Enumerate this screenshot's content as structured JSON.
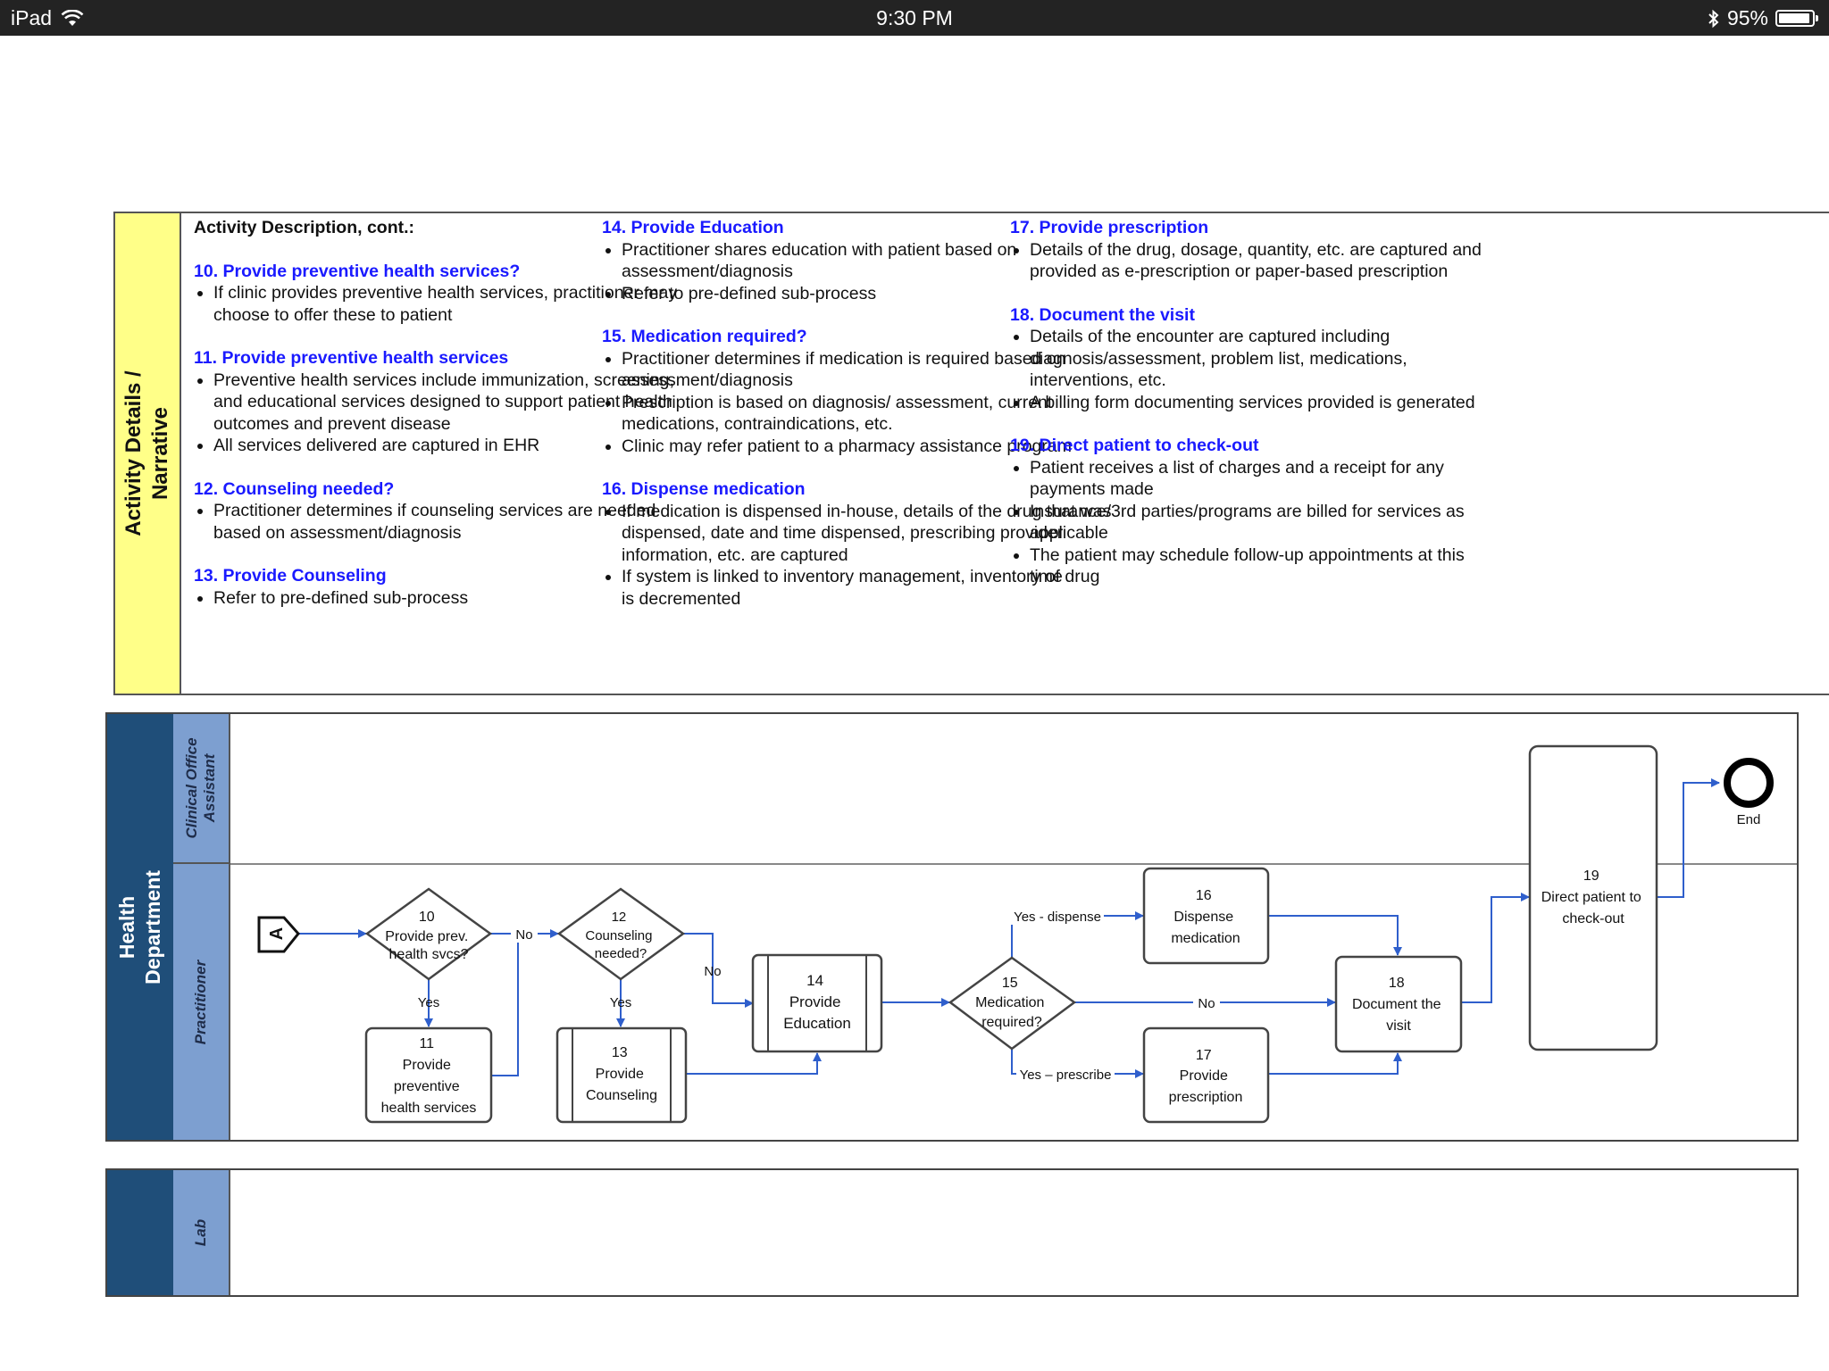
{
  "status_bar": {
    "device": "iPad",
    "time": "9:30 PM",
    "battery": "95%",
    "battery_level": 0.95
  },
  "narrative": {
    "label_line1": "Activity Details /",
    "label_line2": "Narrative",
    "header": "Activity Description, cont.:",
    "columns": [
      [
        {
          "title": "10. Provide preventive health services?",
          "bullets": [
            "If clinic provides preventive health services, practitioner may choose to offer these to patient"
          ]
        },
        {
          "title": "11. Provide preventive health services",
          "bullets": [
            "Preventive health services include immunization, screening, and educational services designed to support patient health outcomes and prevent disease",
            "All services delivered are captured in EHR"
          ]
        },
        {
          "title": "12. Counseling needed?",
          "bullets": [
            "Practitioner determines if counseling services are needed based on assessment/diagnosis"
          ]
        },
        {
          "title": "13. Provide Counseling",
          "bullets": [
            "Refer to pre-defined sub-process"
          ]
        }
      ],
      [
        {
          "title": "14. Provide Education",
          "bullets": [
            "Practitioner shares education with patient based on assessment/diagnosis",
            "Refer to pre-defined sub-process"
          ]
        },
        {
          "title": "15. Medication required?",
          "bullets": [
            "Practitioner determines if medication is required based on assessment/diagnosis",
            "Prescription is based on diagnosis/ assessment, current medications, contraindications, etc.",
            "Clinic may refer patient to a pharmacy assistance program"
          ]
        },
        {
          "title": "16. Dispense medication",
          "bullets": [
            "If medication is dispensed in-house, details of the drug that was dispensed, date and time dispensed, prescribing provider information, etc. are captured",
            "If system is linked to inventory management, inventory of drug is decremented"
          ]
        }
      ],
      [
        {
          "title": "17. Provide prescription",
          "bullets": [
            "Details of the drug, dosage, quantity, etc. are captured and provided as e-prescription or paper-based prescription"
          ]
        },
        {
          "title": "18. Document the visit",
          "bullets": [
            "Details of the encounter are captured including diagnosis/assessment, problem list, medications, interventions, etc.",
            "A billing form documenting services provided is generated"
          ]
        },
        {
          "title": "19. Direct patient to check-out",
          "bullets": [
            "Patient receives a list of charges and a receipt for any payments made",
            "Insurance/3rd parties/programs are billed for services as applicable",
            "The patient may schedule follow-up appointments at this time"
          ]
        }
      ]
    ]
  },
  "pool_health": {
    "label_line1": "Health",
    "label_line2": "Department",
    "lane_coa_line1": "Clinical Office",
    "lane_coa_line2": "Assistant",
    "lane_practitioner": "Practitioner"
  },
  "pool_lab": {
    "lane_label": "Lab"
  },
  "flow": {
    "start_glyph": "A",
    "end_label": "End",
    "n10": [
      "10",
      "Provide prev.",
      "health svcs?"
    ],
    "n11": [
      "11",
      "Provide",
      "preventive",
      "health services"
    ],
    "n12": [
      "12",
      "Counseling",
      "needed?"
    ],
    "n13": [
      "13",
      "Provide",
      "Counseling"
    ],
    "n14": [
      "14",
      "Provide",
      "Education"
    ],
    "n15": [
      "15",
      "Medication",
      "required?"
    ],
    "n16": [
      "16",
      "Dispense",
      "medication"
    ],
    "n17": [
      "17",
      "Provide",
      "prescription"
    ],
    "n18": [
      "18",
      "Document the",
      "visit"
    ],
    "n19": [
      "19",
      "Direct patient to",
      "check-out"
    ],
    "labels": {
      "no_10": "No",
      "yes_10": "Yes",
      "no_12": "No",
      "yes_12": "Yes",
      "yes_dispense": "Yes - dispense",
      "no_15": "No",
      "yes_prescribe": "Yes – prescribe"
    }
  }
}
